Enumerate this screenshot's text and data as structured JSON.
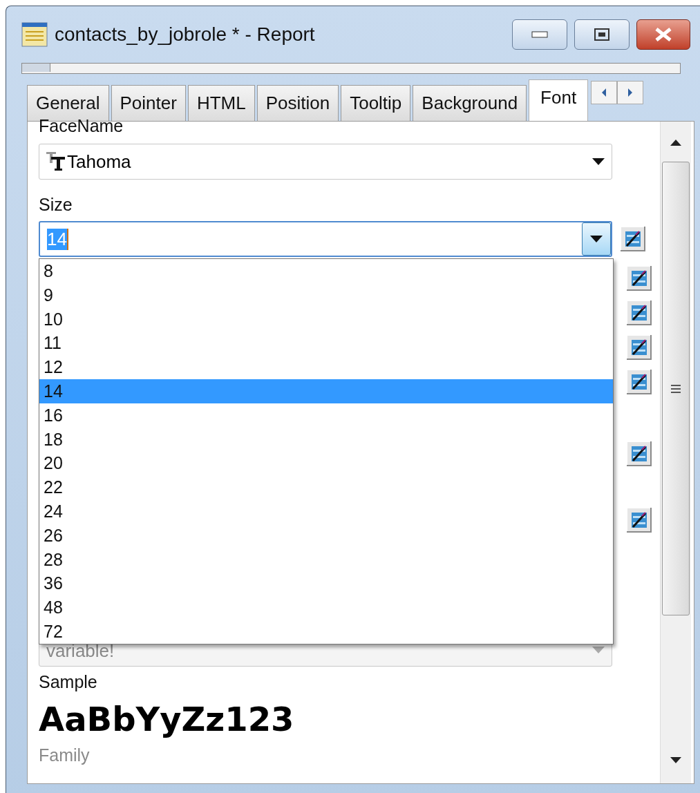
{
  "window": {
    "title": "contacts_by_jobrole * - Report"
  },
  "tabs": [
    {
      "label": "General",
      "selected": false
    },
    {
      "label": "Pointer",
      "selected": false
    },
    {
      "label": "HTML",
      "selected": false
    },
    {
      "label": "Position",
      "selected": false
    },
    {
      "label": "Tooltip",
      "selected": false
    },
    {
      "label": "Background",
      "selected": false
    },
    {
      "label": "Font",
      "selected": true
    }
  ],
  "facename": {
    "label": "FaceName",
    "value": "Tahoma"
  },
  "size": {
    "label": "Size",
    "value": "14",
    "expanded": true
  },
  "size_options": [
    {
      "label": "8",
      "selected": false
    },
    {
      "label": "9",
      "selected": false
    },
    {
      "label": "10",
      "selected": false
    },
    {
      "label": "11",
      "selected": false
    },
    {
      "label": "12",
      "selected": false
    },
    {
      "label": "14",
      "selected": true
    },
    {
      "label": "16",
      "selected": false
    },
    {
      "label": "18",
      "selected": false
    },
    {
      "label": "20",
      "selected": false
    },
    {
      "label": "22",
      "selected": false
    },
    {
      "label": "24",
      "selected": false
    },
    {
      "label": "26",
      "selected": false
    },
    {
      "label": "28",
      "selected": false
    },
    {
      "label": "36",
      "selected": false
    },
    {
      "label": "48",
      "selected": false
    },
    {
      "label": "72",
      "selected": false
    }
  ],
  "covered_field": {
    "value": "variable!",
    "disabled": true
  },
  "sample": {
    "label": "Sample",
    "text": "AaBbYyZz123"
  },
  "family": {
    "label": "Family",
    "disabled": true
  }
}
